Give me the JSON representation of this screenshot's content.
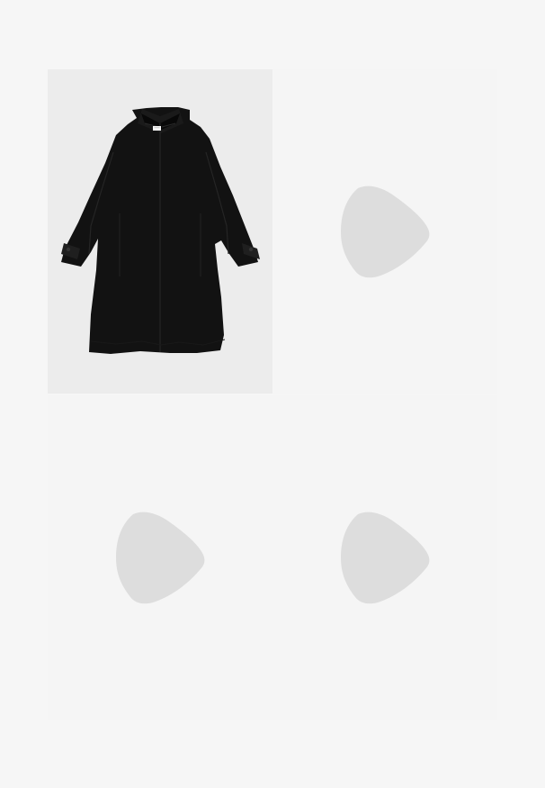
{
  "gallery": {
    "items": [
      {
        "type": "image",
        "icon": "coat-image",
        "color": "#121212"
      },
      {
        "type": "video",
        "icon": "play-icon",
        "color": "#dddddd"
      },
      {
        "type": "video",
        "icon": "play-icon",
        "color": "#dddddd"
      },
      {
        "type": "video",
        "icon": "play-icon",
        "color": "#dddddd"
      }
    ]
  },
  "colors": {
    "page_background": "#f6f6f6",
    "tile_background": "#f5f5f5",
    "image_background": "#ececec",
    "placeholder_icon": "#dddddd"
  }
}
